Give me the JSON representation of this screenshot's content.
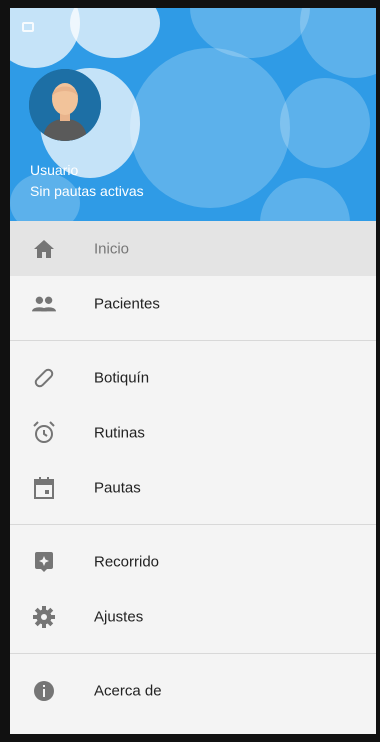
{
  "header": {
    "user_name": "Usuario",
    "user_status": "Sin pautas activas",
    "color": "#2f9be6"
  },
  "menu": {
    "group1": [
      {
        "label": "Inicio",
        "icon": "home-icon",
        "active": true
      },
      {
        "label": "Pacientes",
        "icon": "people-icon"
      }
    ],
    "group2": [
      {
        "label": "Botiquín",
        "icon": "pill-icon"
      },
      {
        "label": "Rutinas",
        "icon": "alarm-icon"
      },
      {
        "label": "Pautas",
        "icon": "calendar-icon"
      }
    ],
    "group3": [
      {
        "label": "Recorrido",
        "icon": "place-icon"
      },
      {
        "label": "Ajustes",
        "icon": "gear-icon"
      }
    ],
    "group4": [
      {
        "label": "Acerca de",
        "icon": "info-icon"
      }
    ]
  }
}
